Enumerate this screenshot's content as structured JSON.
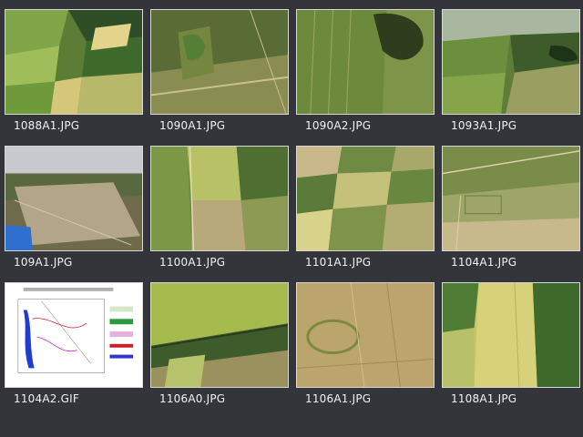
{
  "gallery": {
    "items": [
      {
        "filename": "1088A1.JPG",
        "icon": "aerial-photo-icon"
      },
      {
        "filename": "1090A1.JPG",
        "icon": "aerial-photo-icon"
      },
      {
        "filename": "1090A2.JPG",
        "icon": "aerial-photo-icon"
      },
      {
        "filename": "1093A1.JPG",
        "icon": "aerial-photo-icon"
      },
      {
        "filename": "109A1.JPG",
        "icon": "aerial-photo-icon"
      },
      {
        "filename": "1100A1.JPG",
        "icon": "aerial-photo-icon"
      },
      {
        "filename": "1101A1.JPG",
        "icon": "aerial-photo-icon"
      },
      {
        "filename": "1104A1.JPG",
        "icon": "aerial-photo-icon"
      },
      {
        "filename": "1104A2.GIF",
        "icon": "map-chart-icon"
      },
      {
        "filename": "1106A0.JPG",
        "icon": "aerial-photo-icon"
      },
      {
        "filename": "1106A1.JPG",
        "icon": "aerial-photo-icon"
      },
      {
        "filename": "1108A1.JPG",
        "icon": "aerial-photo-icon"
      }
    ]
  },
  "colors": {
    "background": "#34353b",
    "caption": "#f2f2f2",
    "field_dark": "#3e5b2c",
    "field_mid": "#6d8a3c",
    "field_light": "#c2c36a",
    "field_pale": "#b9aa74"
  }
}
